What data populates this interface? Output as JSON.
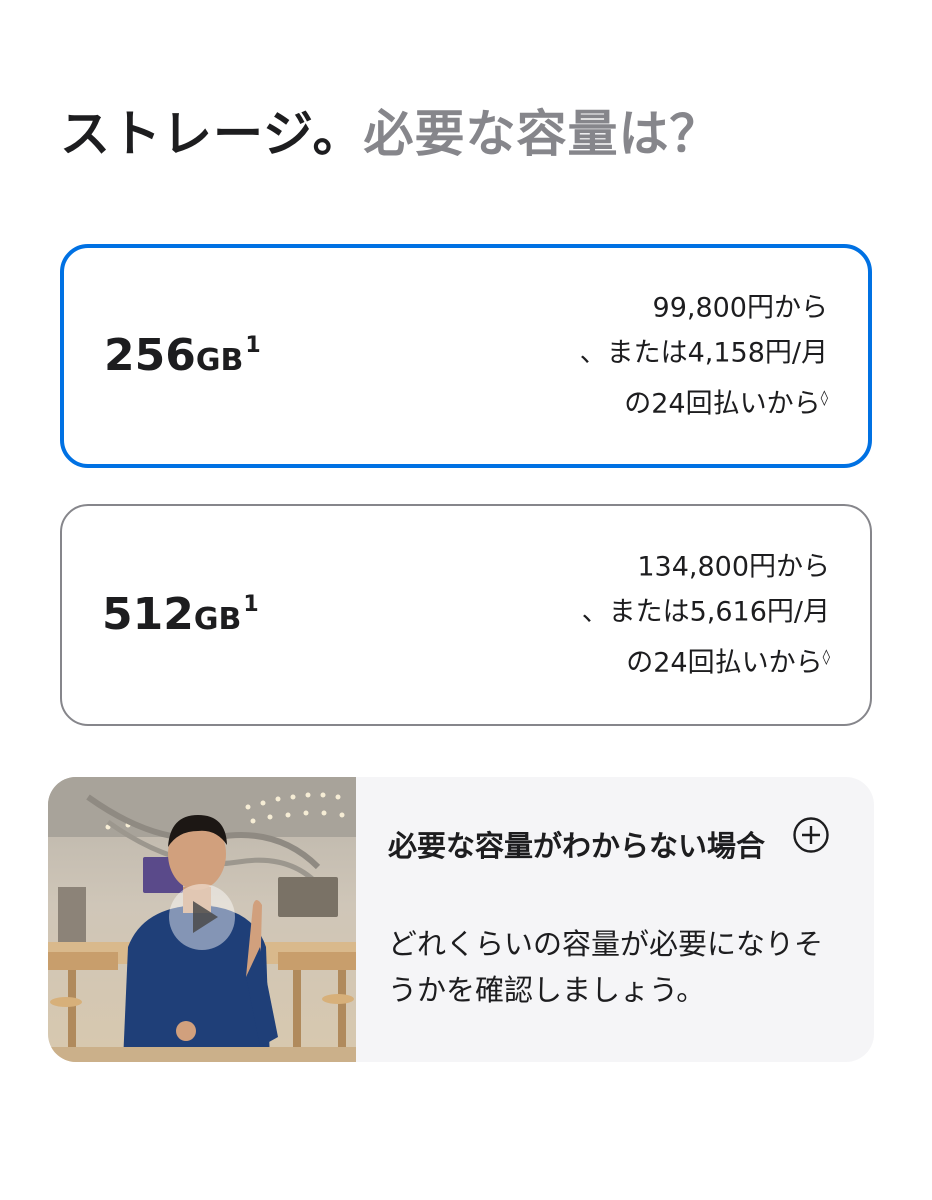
{
  "heading": {
    "strong": "ストレージ。",
    "muted": "必要な容量は？"
  },
  "options": [
    {
      "capacity_number": "256",
      "capacity_unit": "GB",
      "footnote": "1",
      "price_line1": "99,800円から",
      "price_line2": "、または4,158円/月",
      "price_line3": "の24回払いから",
      "price_mark": "◊",
      "selected": true
    },
    {
      "capacity_number": "512",
      "capacity_unit": "GB",
      "footnote": "1",
      "price_line1": "134,800円から",
      "price_line2": "、または5,616円/月",
      "price_line3": "の24回払いから",
      "price_mark": "◊",
      "selected": false
    }
  ],
  "help": {
    "title": "必要な容量がわからない場合",
    "text": "どれくらいの容量が必要になりそうかを確認しましょう。",
    "video_icon": "play-icon",
    "expand_icon": "plus-circle-icon"
  },
  "colors": {
    "accent": "#0071e3",
    "text": "#1d1d1f",
    "muted": "#86868b",
    "card_bg": "#f5f5f7"
  }
}
